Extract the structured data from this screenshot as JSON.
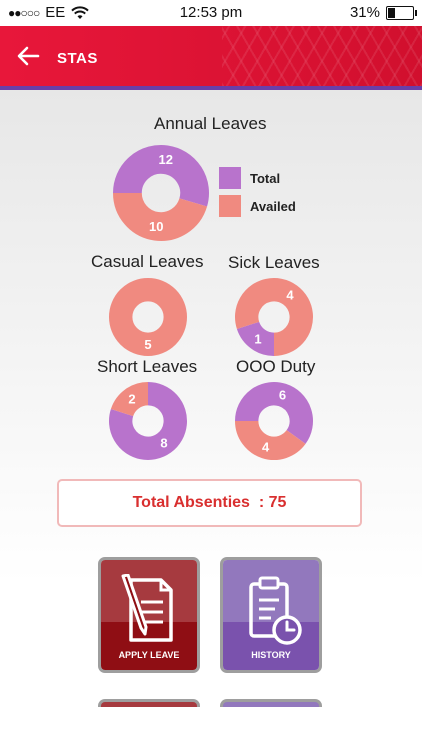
{
  "status_bar": {
    "carrier": "EE",
    "time": "12:53 pm",
    "battery": "31%",
    "battery_level": 0.31
  },
  "header": {
    "title": "STAS"
  },
  "colors": {
    "total": "#b873cc",
    "availed": "#f08a80",
    "header": "#e8173a",
    "apply_tile": "#a3202b",
    "history_tile": "#8d63b5"
  },
  "legend": {
    "total_label": "Total",
    "availed_label": "Availed"
  },
  "chart_data": [
    {
      "type": "pie",
      "title": "Annual Leaves",
      "series": [
        {
          "name": "Total",
          "value": 12
        },
        {
          "name": "Availed",
          "value": 10
        }
      ]
    },
    {
      "type": "pie",
      "title": "Casual Leaves",
      "series": [
        {
          "name": "Availed",
          "value": 5
        }
      ]
    },
    {
      "type": "pie",
      "title": "Sick Leaves",
      "series": [
        {
          "name": "Total",
          "value": 1
        },
        {
          "name": "Availed",
          "value": 4
        }
      ]
    },
    {
      "type": "pie",
      "title": "Short Leaves",
      "series": [
        {
          "name": "Total",
          "value": 8
        },
        {
          "name": "Availed",
          "value": 2
        }
      ]
    },
    {
      "type": "pie",
      "title": "OOO Duty",
      "series": [
        {
          "name": "Total",
          "value": 6
        },
        {
          "name": "Availed",
          "value": 4
        }
      ]
    }
  ],
  "summary": {
    "text": "Total Absenties  : 75"
  },
  "actions": {
    "apply_label": "APPLY LEAVE",
    "history_label": "HISTORY"
  }
}
